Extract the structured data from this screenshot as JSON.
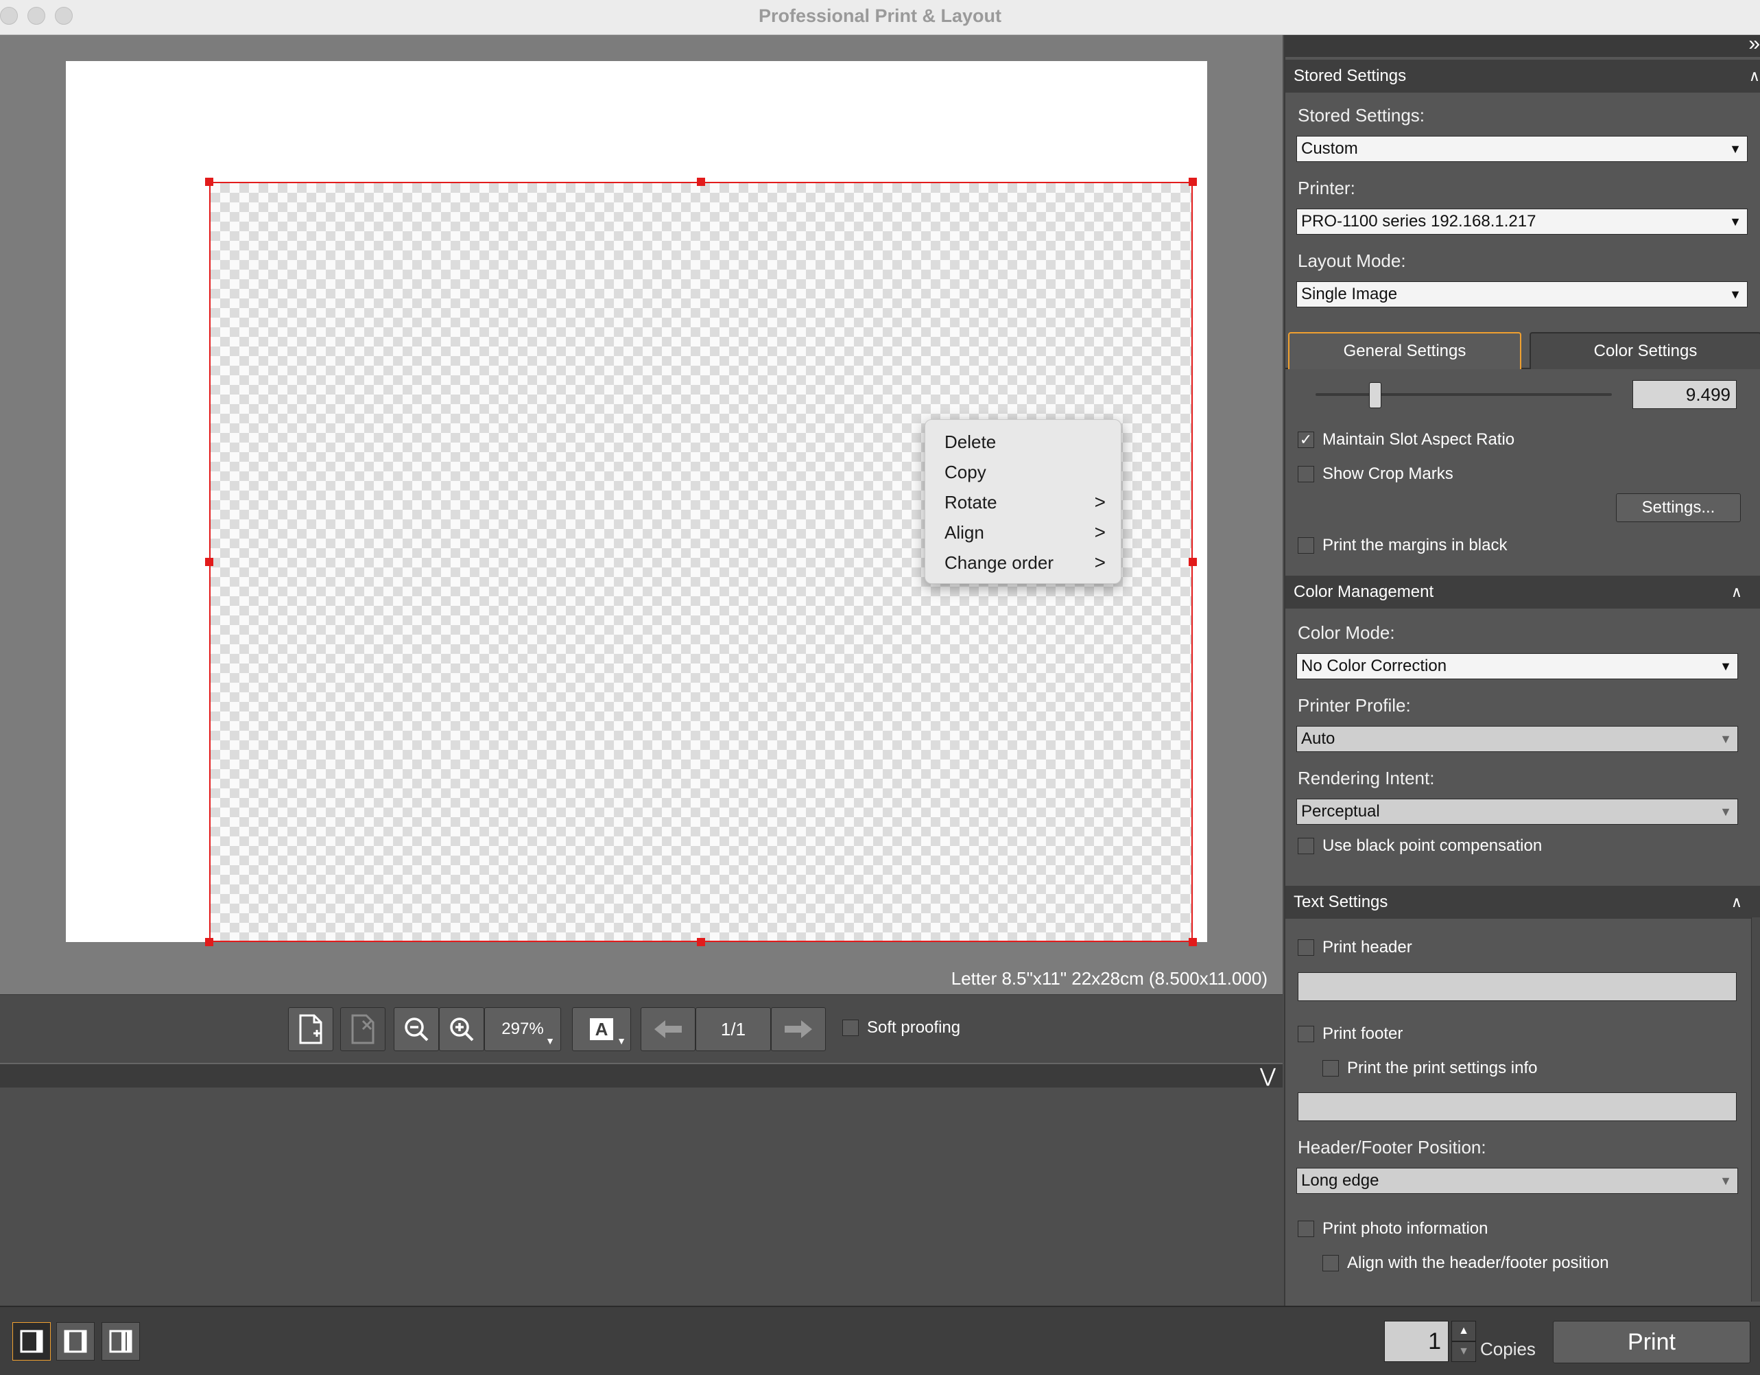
{
  "window": {
    "title": "Professional Print & Layout"
  },
  "preview": {
    "paper_info": "Letter 8.5\"x11\" 22x28cm (8.500x11.000)"
  },
  "context_menu": {
    "items": [
      {
        "label": "Delete",
        "has_submenu": false
      },
      {
        "label": "Copy",
        "has_submenu": false
      },
      {
        "label": "Rotate",
        "has_submenu": true
      },
      {
        "label": "Align",
        "has_submenu": true
      },
      {
        "label": "Change order",
        "has_submenu": true
      }
    ],
    "submenu_glyph": ">"
  },
  "toolbar": {
    "zoom": "297%",
    "page_indicator": "1/1",
    "soft_proofing_label": "Soft proofing",
    "soft_proofing_checked": false,
    "text_tool_glyph": "A"
  },
  "stored_settings": {
    "header": "Stored Settings",
    "stored_settings_label": "Stored Settings:",
    "stored_settings_value": "Custom",
    "printer_label": "Printer:",
    "printer_value": "PRO-1100 series 192.168.1.217",
    "layout_mode_label": "Layout Mode:",
    "layout_mode_value": "Single Image"
  },
  "tabs": {
    "general": "General Settings",
    "color": "Color Settings",
    "active": "general"
  },
  "general": {
    "slider_value": "9.499",
    "slider_fraction": 0.2,
    "maintain_aspect_label": "Maintain Slot Aspect Ratio",
    "maintain_aspect_checked": true,
    "show_crop_marks_label": "Show Crop Marks",
    "show_crop_marks_checked": false,
    "settings_button": "Settings...",
    "print_margins_black_label": "Print the margins in black",
    "print_margins_black_checked": false
  },
  "color_management": {
    "header": "Color Management",
    "color_mode_label": "Color Mode:",
    "color_mode_value": "No Color Correction",
    "printer_profile_label": "Printer Profile:",
    "printer_profile_value": "Auto",
    "rendering_intent_label": "Rendering Intent:",
    "rendering_intent_value": "Perceptual",
    "black_point_label": "Use black point compensation",
    "black_point_checked": false
  },
  "text_settings": {
    "header": "Text Settings",
    "print_header_label": "Print header",
    "print_footer_label": "Print footer",
    "print_settings_info_label": "Print the print settings info",
    "position_label": "Header/Footer Position:",
    "position_value": "Long edge",
    "print_photo_info_label": "Print photo information",
    "align_header_footer_label": "Align with the header/footer position"
  },
  "bottom": {
    "copies_value": "1",
    "copies_label": "Copies",
    "print_button": "Print"
  },
  "colors": {
    "selection": "#e21b1b",
    "accent_tab": "#f0a030",
    "panel_bg": "#565656",
    "paper": "#ffffff"
  }
}
